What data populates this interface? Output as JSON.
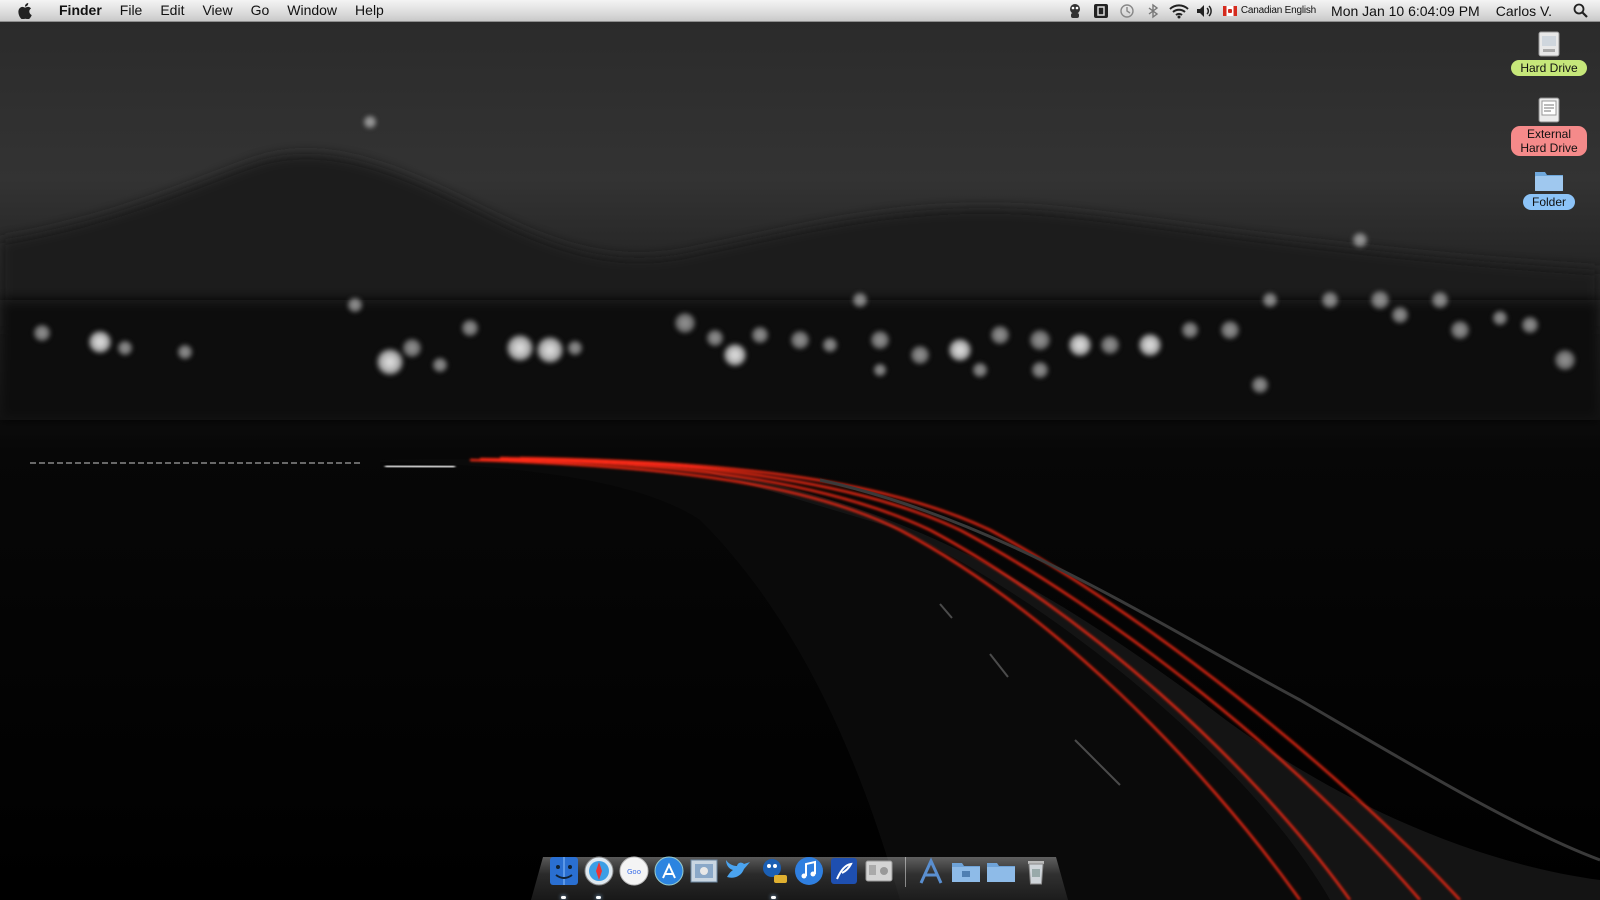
{
  "menubar": {
    "app_name": "Finder",
    "menus": [
      "File",
      "Edit",
      "View",
      "Go",
      "Window",
      "Help"
    ],
    "input_source": "Canadian English",
    "clock": "Mon Jan 10  6:04:09 PM",
    "user": "Carlos V."
  },
  "desktop": {
    "icons": [
      {
        "label": "Hard Drive",
        "icon": "hard-drive-icon",
        "label_color": "#c6e77a"
      },
      {
        "label": "External\nHard Drive",
        "label_lines": [
          "External",
          "Hard Drive"
        ],
        "icon": "external-drive-icon",
        "label_color": "#f58a8a"
      },
      {
        "label": "Folder",
        "icon": "folder-icon",
        "label_color": "#8cc3f7"
      }
    ]
  },
  "dock": {
    "apps": [
      "finder-icon",
      "safari-icon",
      "google-chrome-icon",
      "app-store-icon",
      "mail-icon",
      "twitter-icon",
      "ichat-icon",
      "itunes-icon",
      "font-book-icon",
      "system-preferences-icon"
    ],
    "stacks": [
      "applications-icon",
      "documents-folder-icon",
      "downloads-folder-icon",
      "trash-icon"
    ]
  },
  "colors": {
    "light_trail": "#ff2a14",
    "menubar": "#e6e6e6"
  }
}
